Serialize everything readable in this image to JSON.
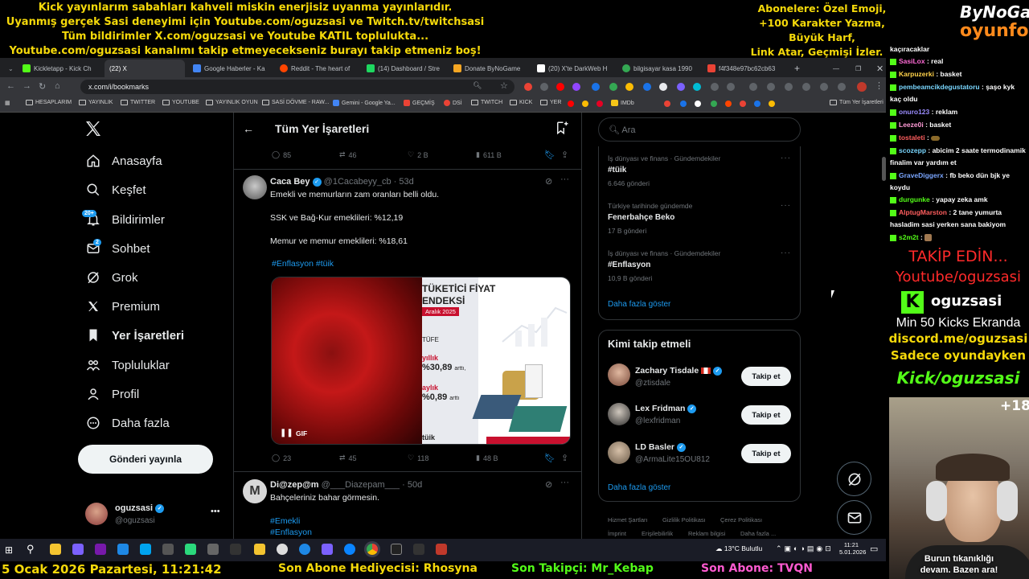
{
  "overlay": {
    "left_lines": [
      "Kick yayınlarım sabahları kahveli miskin enerjisiz uyanma yayınlarıdır.",
      "Uyanmış gerçek Sasi deneyimi için Youtube.com/oguzsasi ve Twitch.tv/twitchsasi",
      "Tüm bildirimler X.com/oguzsasi ve Youtube KATIL toplulukta...",
      "Youtube.com/oguzsasi kanalımı takip etmeyecekseniz burayı takip etmeniz boş!"
    ],
    "right_lines": [
      "Abonelere: Özel Emoji,",
      "+100 Karakter Yazma,",
      "Büyük Harf,",
      "Link Atar, Geçmişi İzler."
    ],
    "logo_top": "ByNoGame",
    "logo_bottom": "oyunfor",
    "bottom": {
      "datetime": "5 Ocak 2026 Pazartesi, 11:21:42",
      "gift": "Son Abone Hediyecisi: Rhosyna",
      "follower": "Son Takipçi: Mr_Kebap",
      "subscriber": "Son Abone: TVQN"
    }
  },
  "browser": {
    "tabs": [
      {
        "label": "Kickletapp - Kick Ch",
        "color": "#53fc18"
      },
      {
        "label": "(22) X",
        "color": "#ffffff",
        "active": true
      },
      {
        "label": "Google Haberler - Ka",
        "color": "#4285f4"
      },
      {
        "label": "Reddit - The heart of",
        "color": "#ff4500"
      },
      {
        "label": "(14) Dashboard / Stre",
        "color": "#1ed760"
      },
      {
        "label": "Donate ByNoGame",
        "color": "#f5a623"
      },
      {
        "label": "(20) X'te DarkWeb H",
        "color": "#ffffff"
      },
      {
        "label": "bilgisayar kasa 1990",
        "color": "#34a853"
      },
      {
        "label": "f4f348e97bc62cb63",
        "color": "#ea4335"
      }
    ],
    "url": "x.com/i/bookmarks",
    "bookmarks": [
      "HESAPLARIM",
      "YAYINLIK",
      "TWITTER",
      "YOUTUBE",
      "YAYINLIK OYUN",
      "SASİ DÖVME - RAW...",
      "Gemini - Google Ya...",
      "GEÇMİŞ",
      "DSİ",
      "TWITCH",
      "KICK",
      "YER",
      "IMDb",
      "Tüm Yer İşaretleri"
    ]
  },
  "sidebar": {
    "items": [
      {
        "label": "Anasayfa",
        "icon": "home-icon"
      },
      {
        "label": "Keşfet",
        "icon": "search-icon"
      },
      {
        "label": "Bildirimler",
        "icon": "bell-icon",
        "badge": "20+"
      },
      {
        "label": "Sohbet",
        "icon": "mail-icon",
        "badge": "2"
      },
      {
        "label": "Grok",
        "icon": "grok-icon"
      },
      {
        "label": "Premium",
        "icon": "x-logo-icon"
      },
      {
        "label": "Yer İşaretleri",
        "icon": "bookmark-icon"
      },
      {
        "label": "Topluluklar",
        "icon": "communities-icon"
      },
      {
        "label": "Profil",
        "icon": "profile-icon"
      },
      {
        "label": "Daha fazla",
        "icon": "more-icon"
      }
    ],
    "post_button": "Gönderi yayınla",
    "account": {
      "name": "oguzsasi",
      "handle": "@oguzsasi"
    }
  },
  "timeline": {
    "title": "Tüm Yer İşaretleri",
    "top_actions": {
      "replies": "85",
      "reposts": "46",
      "likes": "2 B",
      "views": "611 B"
    },
    "post1": {
      "name": "Caca Bey",
      "handle": "@1Cacabeyy_cb",
      "time": "· 53d",
      "line1": "Emekli ve memurların zam oranları belli oldu.",
      "line2": "SSK ve Bağ-Kur emeklileri: %12,19",
      "line3": "Memur ve memur emeklileri: %18,61",
      "tags": "#Enflasyon #tüik",
      "gif_label": "GIF",
      "image_text": {
        "title1": "TÜKETİCİ FİYAT",
        "title2": "ENDEKSİ",
        "date": "Aralık 2025",
        "tufe": "TÜFE",
        "yillik": "yıllık",
        "yillik_val": "%30,89",
        "artti1": "arttı,",
        "aylik": "aylık",
        "aylik_val": "%0,89",
        "artti2": "arttı",
        "logo": "tüik"
      },
      "actions": {
        "replies": "23",
        "reposts": "45",
        "likes": "118",
        "views": "48 B"
      }
    },
    "post2": {
      "name": "Di@zep@m",
      "handle": "@___Diazepam___",
      "time": "· 50d",
      "line1": "Bahçeleriniz bahar görmesin.",
      "tag1": "#Emekli",
      "tag2": "#Enflasyon"
    }
  },
  "right": {
    "search_placeholder": "Ara",
    "trends": [
      {
        "category": "İş dünyası ve finans · Gündemdekiler",
        "title": "#tüik",
        "count": "6.646 gönderi"
      },
      {
        "category": "Türkiye tarihinde gündemde",
        "title": "Fenerbahçe Beko",
        "count": "17 B gönderi"
      },
      {
        "category": "İş dünyası ve finans · Gündemdekiler",
        "title": "#Enflasyon",
        "count": "10,9 B gönderi"
      }
    ],
    "show_more": "Daha fazla göster",
    "who_to_follow": "Kimi takip etmeli",
    "suggestions": [
      {
        "name": "Zachary Tisdale",
        "handle": "@ztisdale",
        "button": "Takip et"
      },
      {
        "name": "Lex Fridman",
        "handle": "@lexfridman",
        "button": "Takip et"
      },
      {
        "name": "LD Basler",
        "handle": "@ArmaLite15OU812",
        "button": "Takip et"
      }
    ],
    "show_more2": "Daha fazla göster",
    "footer1": [
      "Hizmet Şartları",
      "Gizlilik Politikası",
      "Çerez Politikası"
    ],
    "footer2": [
      "İmprint",
      "Erişilebilirlik",
      "Reklam bilgisi",
      "Daha fazla ..."
    ]
  },
  "taskbar": {
    "weather": "13°C Bulutlu",
    "time": "11:21",
    "date": "5.01.2026"
  },
  "chat": {
    "messages": [
      {
        "user": "",
        "text": "kaçıracaklar",
        "color": "#ffffff"
      },
      {
        "user": "SasiLox",
        "text": ": real",
        "color": "#ff6bd6"
      },
      {
        "user": "Karpuzerki",
        "text": ": basket",
        "color": "#ffd24a"
      },
      {
        "user": "pembeamcikdegustatoru",
        "text": ": şaşo kyk kaç oldu",
        "color": "#7ad7ff"
      },
      {
        "user": "onuro123",
        "text": ": reklam",
        "color": "#9b8cff"
      },
      {
        "user": "Leeze0i",
        "text": ": basket",
        "color": "#ff9bd6"
      },
      {
        "user": "tostaleti",
        "text": ":",
        "color": "#ff5e5e"
      },
      {
        "user": "scozepp",
        "text": ": abicim 2 saate termodinamik finalim var yardım et",
        "color": "#7ad7ff"
      },
      {
        "user": "GraveDiggerx",
        "text": ": fb beko dün bjk ye koydu",
        "color": "#7aa6ff"
      },
      {
        "user": "durgunke",
        "text": ": yapay zeka amk",
        "color": "#53fc18"
      },
      {
        "user": "AlptugMarston",
        "text": ": 2 tane yumurta hasladim sasi yerken sana bakiyom",
        "color": "#ff5e5e"
      },
      {
        "user": "s2m2t",
        "text": ":",
        "color": "#53fc18"
      }
    ],
    "cta1": "TAKİP EDİN...",
    "cta2": "Youtube/oguzsasi",
    "kick_name": "oguzsasi",
    "cta3": "Min 50 Kicks Ekranda",
    "cta4": "discord.me/oguzsasi",
    "cta5": "Sadece oyundayken",
    "cta6": "Kick/oguzsasi",
    "age": "+18",
    "caption1": "Burun tıkanıklığı",
    "caption2": "devam. Bazen ara!"
  }
}
